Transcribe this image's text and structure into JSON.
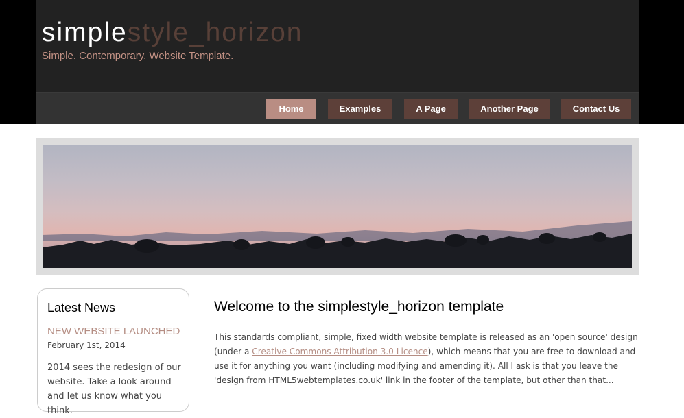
{
  "site": {
    "logo_part1": "simple",
    "logo_part2": "style_horizon",
    "slogan": "Simple. Contemporary. Website Template."
  },
  "menu": {
    "items": [
      {
        "label": "Home",
        "active": true
      },
      {
        "label": "Examples",
        "active": false
      },
      {
        "label": "A Page",
        "active": false
      },
      {
        "label": "Another Page",
        "active": false
      },
      {
        "label": "Contact Us",
        "active": false
      }
    ]
  },
  "sidebar": {
    "title": "Latest News",
    "news_title": "NEW WEBSITE LAUNCHED",
    "news_date": "February 1st, 2014",
    "news_body": "2014 sees the redesign of our website. Take a look around and let us know what you think."
  },
  "content": {
    "title": "Welcome to the simplestyle_horizon template",
    "para_part1": "This standards compliant, simple, fixed width website template is released as an 'open source' design (under a ",
    "link_text": "Creative Commons Attribution 3.0 Licence",
    "para_part2": "), which means that you are free to download and use it for anything you want (including modifying and amending it). All I ask is that you leave the 'design from HTML5webtemplates.co.uk' link in the footer of the template, but other than that..."
  },
  "colors": {
    "header_bg": "#222222",
    "menu_bg": "#333333",
    "menu_item": "#5d4039",
    "menu_item_active": "#b98d83",
    "accent": "#b58e84"
  }
}
